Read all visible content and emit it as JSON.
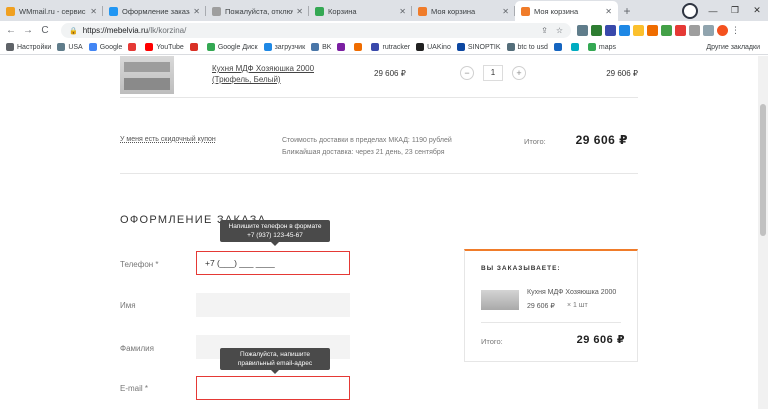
{
  "tabs": [
    {
      "title": "WMmail.ru - сервис по",
      "icon": "wmmail-favicon",
      "color": "#f0a020"
    },
    {
      "title": "Оформление заказа | и",
      "icon": "mebelvia-favicon",
      "color": "#2196f3"
    },
    {
      "title": "Пожалуйста, отключите",
      "icon": "globe-favicon",
      "color": "#9e9e9e"
    },
    {
      "title": "Корзина",
      "icon": "sheets-favicon",
      "color": "#34a853"
    },
    {
      "title": "Моя корзина",
      "icon": "via-favicon",
      "color": "#f07c2a"
    },
    {
      "title": "Моя корзина",
      "icon": "via-favicon",
      "color": "#f07c2a",
      "active": true
    }
  ],
  "address": {
    "host": "https://mebelvia.ru",
    "path": "/lk/korzina/"
  },
  "bookmarks": [
    {
      "label": "Настройки",
      "color": "#5f6368"
    },
    {
      "label": "USA",
      "color": "#607d8b"
    },
    {
      "label": "Google",
      "color": "#4285f4"
    },
    {
      "label": "",
      "color": "#e53935"
    },
    {
      "label": "YouTube",
      "color": "#ff0000"
    },
    {
      "label": "",
      "color": "#d93025"
    },
    {
      "label": "Google Диск",
      "color": "#34a853"
    },
    {
      "label": "загрузчик",
      "color": "#1e88e5"
    },
    {
      "label": "BK",
      "color": "#4a76a8"
    },
    {
      "label": "",
      "color": "#7b1fa2"
    },
    {
      "label": "",
      "color": "#ef6c00"
    },
    {
      "label": "rutracker",
      "color": "#3949ab"
    },
    {
      "label": "UAKino",
      "color": "#212121"
    },
    {
      "label": "SINOPTIK",
      "color": "#0d47a1"
    },
    {
      "label": "btc to usd",
      "color": "#546e7a"
    },
    {
      "label": "",
      "color": "#1565c0"
    },
    {
      "label": "",
      "color": "#00acc1"
    },
    {
      "label": "maps",
      "color": "#34a853"
    }
  ],
  "bookmarks_right": "Другие закладки",
  "product": {
    "name": "Кухня МДФ Хозяюшка 2000 (Трюфель, Белый)",
    "price": "29 606 ₽",
    "qty_minus": "−",
    "qty": "1",
    "qty_plus": "+",
    "total": "29 606 ₽"
  },
  "summary": {
    "coupon": "У меня есть скидочный купон",
    "delivery_cost": "Стоимость доставки в пределах МКАД: 1190 рублей",
    "delivery_date": "Ближайшая доставка: через 21 день, 23 сентября",
    "total_label": "Итого:",
    "total_value": "29 606 ₽"
  },
  "order": {
    "title": "ОФОРМЛЕНИЕ ЗАКАЗА",
    "phone_tip": "Напишите телефон в формате +7 (937) 123-45-67",
    "phone_label": "Телефон *",
    "phone_value": "+7 (___) ___ ____",
    "name_label": "Имя",
    "surname_label": "Фамилия",
    "email_tip": "Пожалуйста, напишите правильный email-адрес",
    "email_label": "E-mail *"
  },
  "card": {
    "title": "ВЫ ЗАКАЗЫВАЕТЕ:",
    "item_name": "Кухня МДФ Хозяюшка 2000",
    "item_price": "29 606 ₽",
    "item_qty": "× 1 шт",
    "total_label": "Итого:",
    "total_value": "29 606 ₽"
  }
}
